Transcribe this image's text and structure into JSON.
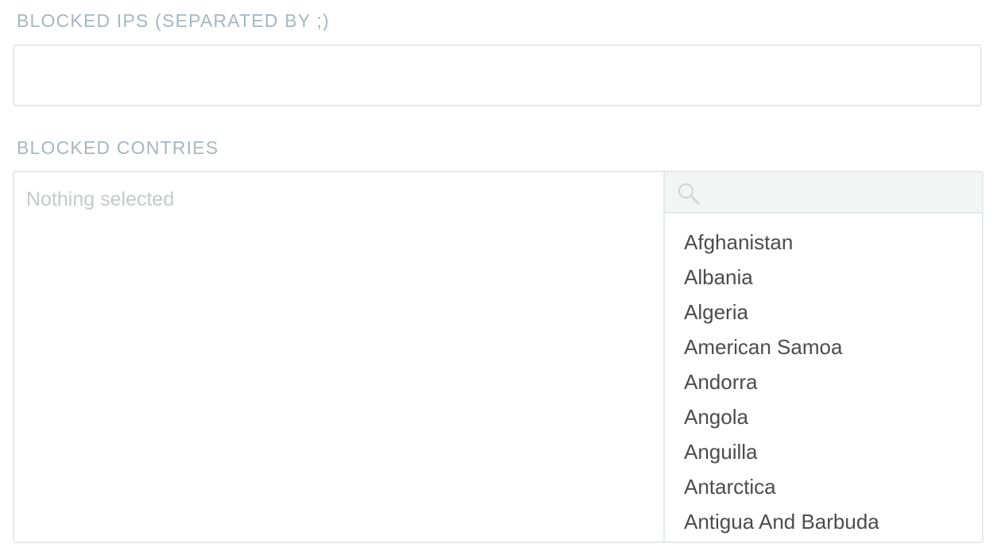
{
  "blocked_ips": {
    "label": "BLOCKED IPS (SEPARATED BY ;)",
    "value": "",
    "placeholder": ""
  },
  "blocked_countries": {
    "label": "BLOCKED CONTRIES",
    "selected_placeholder": "Nothing selected",
    "search": {
      "icon": "search-icon",
      "value": "",
      "placeholder": ""
    },
    "options": [
      "Afghanistan",
      "Albania",
      "Algeria",
      "American Samoa",
      "Andorra",
      "Angola",
      "Anguilla",
      "Antarctica",
      "Antigua And Barbuda"
    ]
  },
  "colors": {
    "label": "#a7b6bf",
    "border": "#e6e9eb",
    "search_bg": "#f3f4f4",
    "placeholder": "#c6c9cb",
    "option_text": "#4c4c4c"
  }
}
